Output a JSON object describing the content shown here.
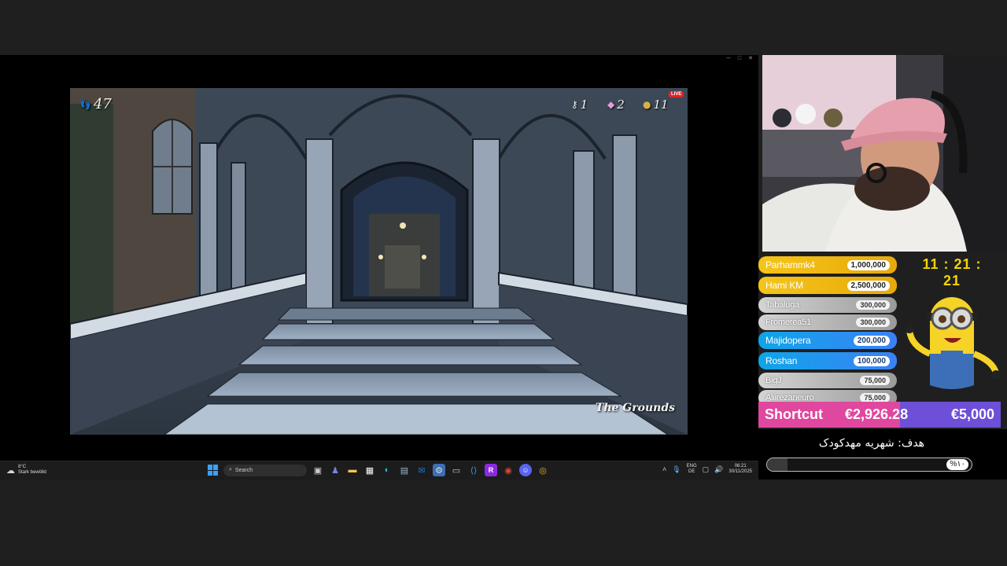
{
  "game_hud": {
    "steps": "47",
    "keys": "1",
    "gems": "2",
    "coins": "11",
    "live_badge": "LIVE",
    "location": "The Grounds"
  },
  "taskbar": {
    "weather_temp": "8°C",
    "weather_desc": "Stark bewölkt",
    "search_placeholder": "Search",
    "language_top": "ENG",
    "language_bottom": "DE",
    "time": "06:21",
    "date": "30/11/2025",
    "pinned_apps": [
      "file-explorer",
      "teams",
      "folder",
      "store",
      "edge",
      "widgets",
      "outlook",
      "settings",
      "terminal",
      "vscode",
      "rider",
      "app-red",
      "discord",
      "chrome"
    ]
  },
  "donors": [
    {
      "name": "Parhammk4",
      "amount": "1,000,000",
      "tier": "gold"
    },
    {
      "name": "Hami KM",
      "amount": "2,500,000",
      "tier": "gold"
    },
    {
      "name": "Tabaluga",
      "amount": "300,000",
      "tier": "grey"
    },
    {
      "name": "Fromerea51",
      "amount": "300,000",
      "tier": "grey"
    },
    {
      "name": "Majidopera",
      "amount": "200,000",
      "tier": "blue"
    },
    {
      "name": "Roshan",
      "amount": "100,000",
      "tier": "blue"
    },
    {
      "name": "BigJ",
      "amount": "75,000",
      "tier": "grey"
    },
    {
      "name": "Aliirezaneuro",
      "amount": "75,000",
      "tier": "grey"
    }
  ],
  "clock": "11 : 21 : 21",
  "goal": {
    "name": "Shortcut",
    "current": "€2,926.28",
    "target": "€5,000",
    "progress": 0.585,
    "text": "هدف: شهریه مهدکودک",
    "percent_label": "%۱۰",
    "percent_value": 0.1
  },
  "colors": {
    "gold": "#f5c518",
    "blue": "#0ea5e9",
    "grey": "#b0b0b0",
    "goal_pink": "#e0479e",
    "goal_purple": "#6d4fd8",
    "clock_yellow": "#f5d300"
  }
}
